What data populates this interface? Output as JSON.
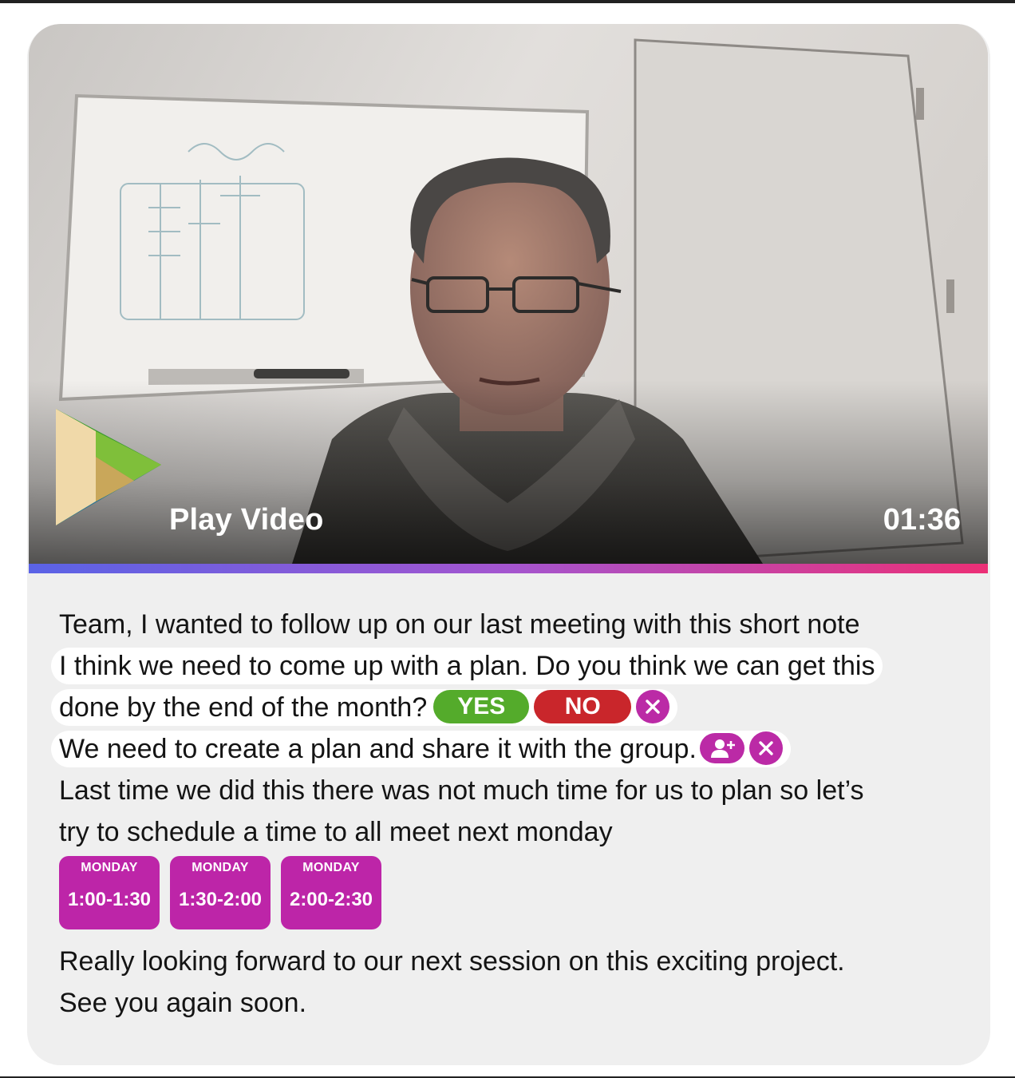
{
  "video": {
    "play_label": "Play Video",
    "duration": "01:36",
    "logo_icon": "play-triangle-logo",
    "progress_gradient": [
      "#5a63e6",
      "#a455cf",
      "#ec2f76"
    ]
  },
  "message": {
    "line1": "Team, I wanted to follow up on our last meeting with this short note",
    "line2": "I think we need to come up with a plan. Do you think we can get this",
    "line3": "done by the end of the month?",
    "yes_label": "YES",
    "no_label": "NO",
    "line4": "We need to create a plan and share it with the group.",
    "line5": "Last time we did this there was not much time for us to plan so let’s",
    "line6": "try to schedule a time to all meet next monday",
    "slots": [
      {
        "day": "MONDAY",
        "time": "1:00-1:30"
      },
      {
        "day": "MONDAY",
        "time": "1:30-2:00"
      },
      {
        "day": "MONDAY",
        "time": "2:00-2:30"
      }
    ],
    "line7": "Really looking forward to our next session on this exciting project.",
    "line8": "See you again soon."
  },
  "colors": {
    "yes": "#54ab2b",
    "no": "#c9262b",
    "accent": "#bb2aa6",
    "card_background": "#efefef"
  }
}
